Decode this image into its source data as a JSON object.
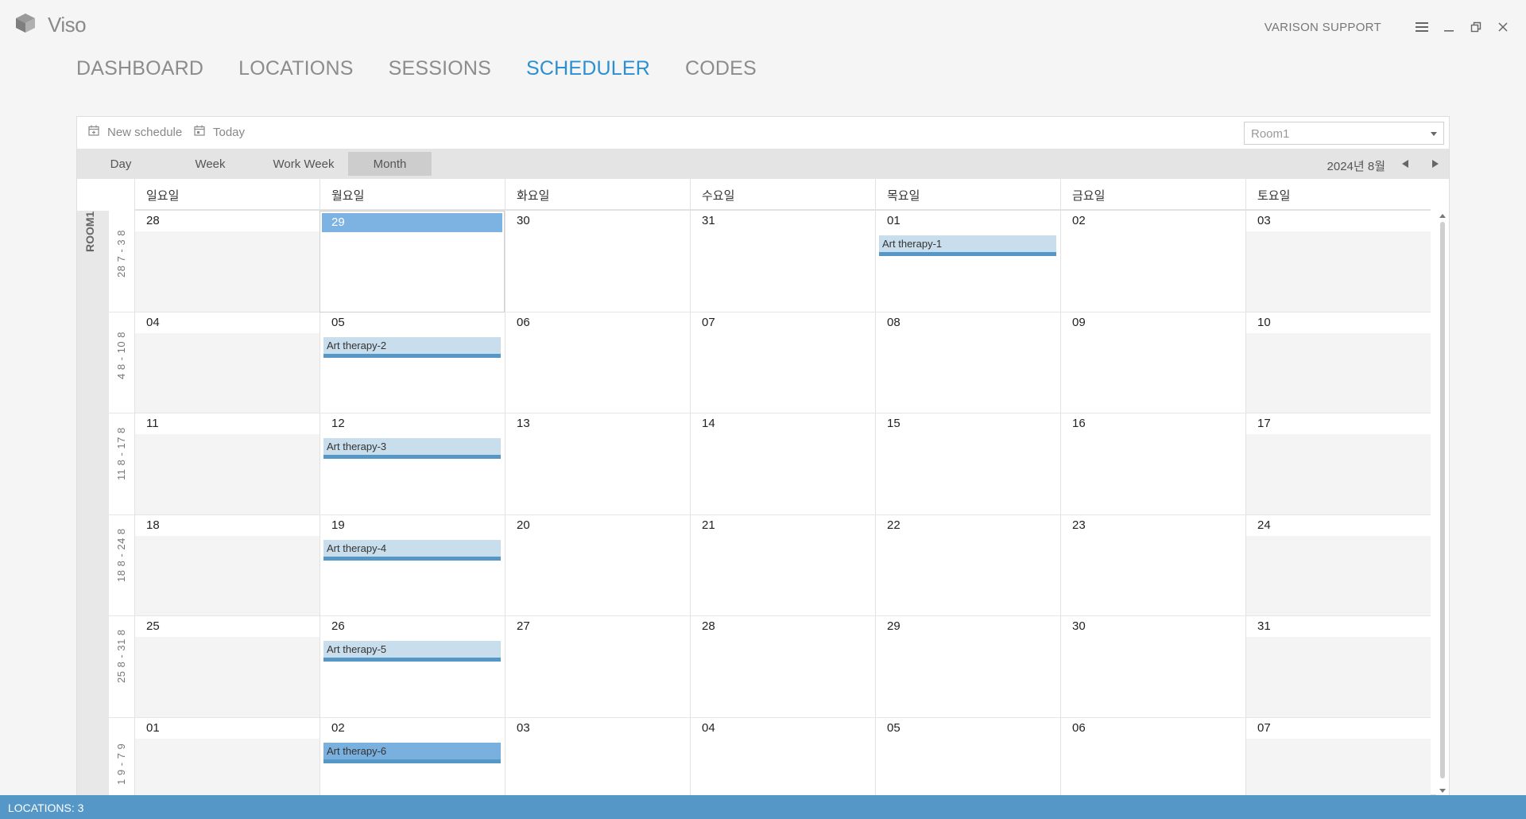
{
  "app": {
    "name": "Viso",
    "support_label": "VARISON SUPPORT"
  },
  "nav": {
    "items": [
      {
        "label": "DASHBOARD",
        "active": false
      },
      {
        "label": "LOCATIONS",
        "active": false
      },
      {
        "label": "SESSIONS",
        "active": false
      },
      {
        "label": "SCHEDULER",
        "active": true
      },
      {
        "label": "CODES",
        "active": false
      }
    ]
  },
  "toolbar": {
    "new_schedule": "New schedule",
    "today": "Today",
    "room_select": "Room1"
  },
  "views": {
    "day": "Day",
    "week": "Week",
    "work_week": "Work Week",
    "month": "Month",
    "active": "Month"
  },
  "period": "2024년 8월",
  "day_headers": [
    "일요일",
    "월요일",
    "화요일",
    "수요일",
    "목요일",
    "금요일",
    "토요일"
  ],
  "room_label": "ROOM1",
  "weeks": [
    {
      "range": "28 7 - 3 8",
      "days": [
        "28",
        "29",
        "30",
        "31",
        "01",
        "02",
        "03"
      ]
    },
    {
      "range": "4 8 - 10 8",
      "days": [
        "04",
        "05",
        "06",
        "07",
        "08",
        "09",
        "10"
      ]
    },
    {
      "range": "11 8 - 17 8",
      "days": [
        "11",
        "12",
        "13",
        "14",
        "15",
        "16",
        "17"
      ]
    },
    {
      "range": "18 8 - 24 8",
      "days": [
        "18",
        "19",
        "20",
        "21",
        "22",
        "23",
        "24"
      ]
    },
    {
      "range": "25 8 - 31 8",
      "days": [
        "25",
        "26",
        "27",
        "28",
        "29",
        "30",
        "31"
      ]
    },
    {
      "range": "1 9 - 7 9",
      "days": [
        "01",
        "02",
        "03",
        "04",
        "05",
        "06",
        "07"
      ]
    }
  ],
  "appointments": [
    {
      "title": "Art therapy-1"
    },
    {
      "title": "Art therapy-2"
    },
    {
      "title": "Art therapy-3"
    },
    {
      "title": "Art therapy-4"
    },
    {
      "title": "Art therapy-5"
    },
    {
      "title": "Art therapy-6"
    }
  ],
  "status": {
    "text": "LOCATIONS: 3"
  },
  "colors": {
    "accent": "#2b8fd3",
    "status_bar": "#5597c7",
    "today_highlight": "#7db3e2",
    "appointment": "#c9deec"
  }
}
